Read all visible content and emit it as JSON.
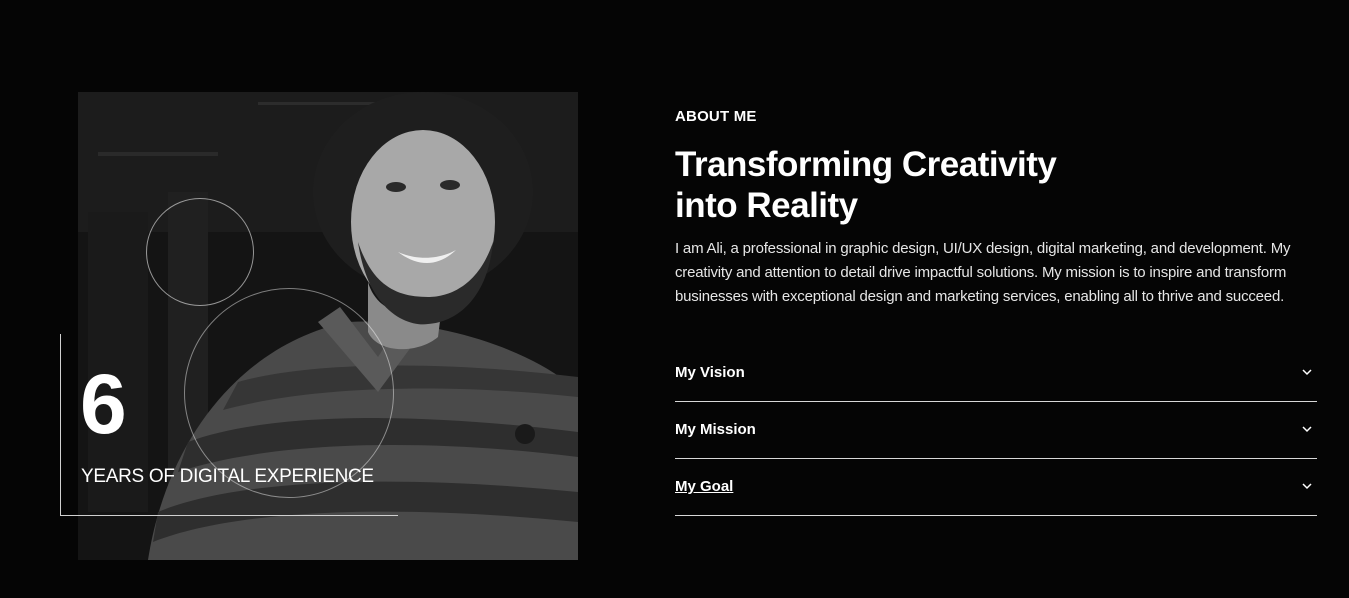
{
  "experience": {
    "number": "6",
    "label": "YEARS OF DIGITAL EXPERIENCE"
  },
  "about": {
    "eyebrow": "ABOUT ME",
    "title_line1": "Transforming Creativity",
    "title_line2": "into Reality",
    "intro": "I am Ali, a professional in graphic design, UI/UX design, digital marketing, and development. My creativity and attention to detail drive impactful solutions. My mission is to inspire and transform businesses with exceptional design and marketing services, enabling all to thrive and succeed."
  },
  "accordion": {
    "items": [
      {
        "label": "My Vision",
        "icon": "chevron-down-icon"
      },
      {
        "label": "My Mission",
        "icon": "chevron-down-icon"
      },
      {
        "label": "My Goal",
        "icon": "chevron-down-icon"
      }
    ]
  },
  "colors": {
    "background": "#050505",
    "text": "#ffffff",
    "divider": "#d8d8d8"
  }
}
